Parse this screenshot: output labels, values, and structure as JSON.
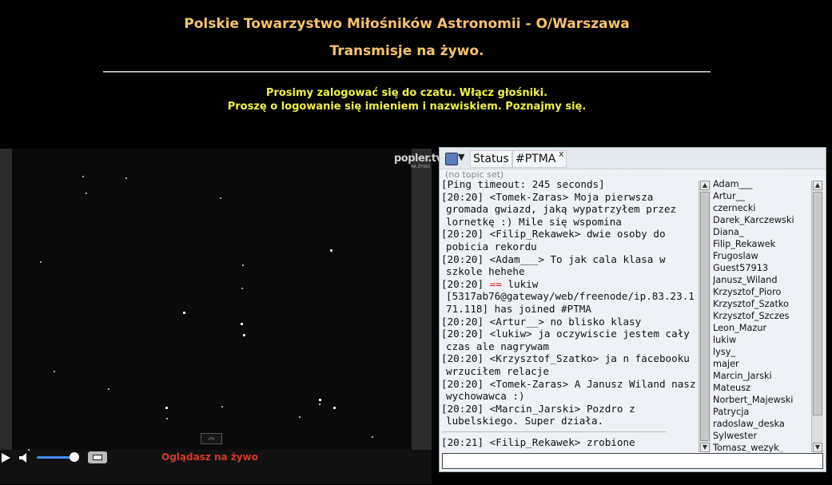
{
  "header": {
    "title": "Polskie Towarzystwo Miłośników Astronomii - O/Warszawa",
    "subtitle": "Transmisje na żywo.",
    "notice_line1": "Prosimy zalogować się do czatu. Włącz głośniki.",
    "notice_line2": "Proszę o logowanie się imieniem i nazwiskiem. Poznajmy się."
  },
  "player": {
    "logo": "popler.tv",
    "logo_sub": "NA ŻYWO",
    "live_label": "Oglądasz na żywo",
    "volume_level": 0.85,
    "collapse_glyph": "︽"
  },
  "chat": {
    "tabs": [
      {
        "label": "Status"
      },
      {
        "label": "#PTMA"
      }
    ],
    "close_glyph": "x",
    "topic": "(no topic set)",
    "messages": [
      {
        "text": "[Ping timeout: 245 seconds]"
      },
      {
        "text": "[20:20] <Tomek-Zaras> Moja pierwsza gromada gwiazd, jaką wypatrzyłem przez lornetkę :) Mile się wspomina"
      },
      {
        "text": "[20:20] <Filip_Rekawek> dwie osoby do pobicia rekordu"
      },
      {
        "text": "[20:20] <Adam___> To jak cala klasa w szkole hehehe"
      },
      {
        "time": "[20:20] ",
        "marker": "==",
        "rest": " lukiw [5317ab76@gateway/web/freenode/ip.83.23.171.118] has joined #PTMA"
      },
      {
        "text": "[20:20] <Artur__> no blisko klasy"
      },
      {
        "text": "[20:20] <lukiw> ja oczywiscie jestem cały czas ale nagrywam"
      },
      {
        "text": "[20:20] <Krzysztof_Szatko> ja n facebooku wrzuciłem relacje"
      },
      {
        "text": "[20:20] <Tomek-Zaras> A Janusz Wiland nasz wychowawca :)"
      },
      {
        "text": "[20:20] <Marcin_Jarski> Pozdro z lubelskiego. Super działa."
      },
      {
        "text": "[20:21] <Filip_Rekawek> zrobione"
      }
    ],
    "users": [
      "Adam___",
      "Artur__",
      "czernecki",
      "Darek_Karczewski",
      "Diana_",
      "Filip_Rekawek",
      "Frugoslaw",
      "Guest57913",
      "Janusz_Wiland",
      "Krzysztof_Pioro",
      "Krzysztof_Szatko",
      "Krzysztof_Szczes",
      "Leon_Mazur",
      "lukiw",
      "lysy_",
      "majer",
      "Marcin_Jarski",
      "Mateusz",
      "Norbert_Majewski",
      "Patrycja",
      "radoslaw_deska",
      "Sylwester",
      "Tomasz_wezyk_"
    ],
    "input_value": ""
  },
  "colors": {
    "title": "#f5c46c",
    "notice": "#f0f04a",
    "live": "#d03a2a",
    "join_marker": "#dd1111"
  }
}
